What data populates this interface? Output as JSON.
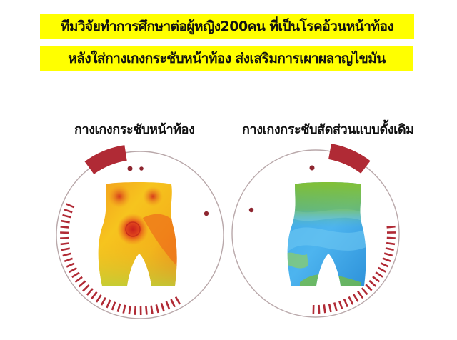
{
  "headline": {
    "line1": "ทีมวิจัยทำการศึกษาต่อผู้หญิง200คน ที่เป็นโรคอ้วนหน้าท้อง",
    "line2": "หลังใส่กางเกงกระชับหน้าท้อง ส่งเสริมการเผาผลาญไขมัน"
  },
  "comparison": {
    "left_label": "กางเกงกระชับหน้าท้อง",
    "right_label": "กางเกงกระชับสัดส่วนแบบดั้งเดิม"
  },
  "colors": {
    "banner": "#ffff00",
    "ring_red": "#b02a35",
    "ring_gray": "#b9a8aa",
    "hot": "#e8561c",
    "warm": "#f6c21c",
    "cool": "#2e9fe0",
    "green": "#7cbf2e"
  }
}
